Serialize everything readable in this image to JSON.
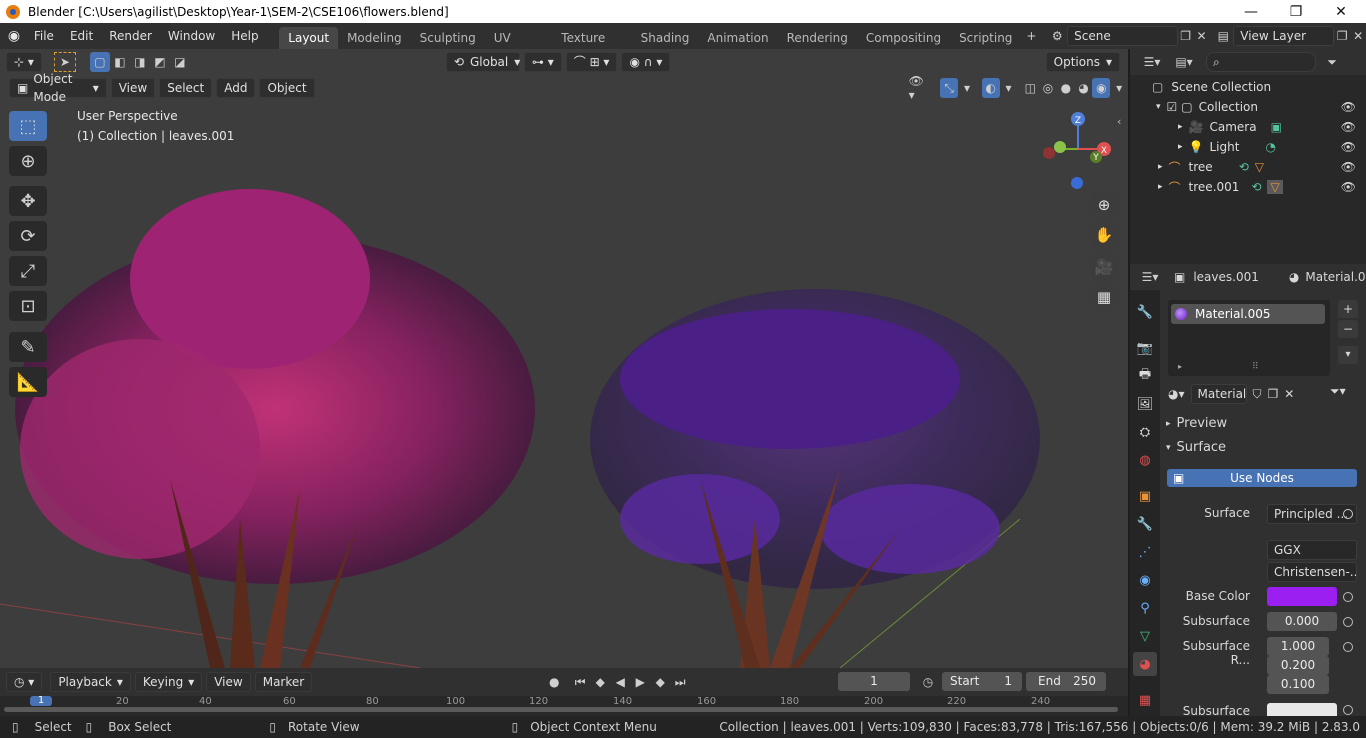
{
  "window": {
    "title": "Blender [C:\\Users\\agilist\\Desktop\\Year-1\\SEM-2\\CSE106\\flowers.blend]",
    "minimize": "—",
    "maximize": "❐",
    "close": "✕"
  },
  "menu": [
    "File",
    "Edit",
    "Render",
    "Window",
    "Help"
  ],
  "workspaces": [
    "Layout",
    "Modeling",
    "Sculpting",
    "UV Editing",
    "Texture Paint",
    "Shading",
    "Animation",
    "Rendering",
    "Compositing",
    "Scripting"
  ],
  "scene": {
    "label": "Scene",
    "view_layer": "View Layer"
  },
  "viewport": {
    "transform_orientation": "Global",
    "mode": "Object Mode",
    "header_menus": [
      "View",
      "Select",
      "Add",
      "Object"
    ],
    "overlay_title": "User Perspective",
    "overlay_subtitle": "(1) Collection | leaves.001",
    "options": "Options",
    "gizmo": {
      "x": "X",
      "y": "Y",
      "z": "Z"
    }
  },
  "outliner": {
    "scene_collection": "Scene Collection",
    "items": [
      {
        "name": "Collection"
      },
      {
        "name": "Camera"
      },
      {
        "name": "Light"
      },
      {
        "name": "tree"
      },
      {
        "name": "tree.001"
      }
    ]
  },
  "properties": {
    "object_name": "leaves.001",
    "material_tab": "Material.0",
    "slot": "Material.005",
    "material_field": "Material...",
    "panels": {
      "preview": "Preview",
      "surface": "Surface"
    },
    "use_nodes": "Use Nodes",
    "surface_label": "Surface",
    "surface_value": "Principled ...",
    "distribution": "GGX",
    "subsurface_method": "Christensen-...",
    "base_color_label": "Base Color",
    "base_color": "#9b1ff0",
    "subsurface_label": "Subsurface",
    "subsurface_value": "0.000",
    "subsurface_radius_label": "Subsurface R...",
    "subsurface_radius": [
      "1.000",
      "0.200",
      "0.100"
    ],
    "subsurface_color_label": "Subsurface C..."
  },
  "timeline": {
    "menus": [
      "Playback",
      "Keying",
      "View",
      "Marker"
    ],
    "current_frame": "1",
    "start_label": "Start",
    "start": "1",
    "end_label": "End",
    "end": "250",
    "ticks": [
      "1",
      "20",
      "40",
      "60",
      "80",
      "100",
      "120",
      "140",
      "160",
      "180",
      "200",
      "220",
      "240"
    ]
  },
  "statusbar": {
    "select": "Select",
    "box_select": "Box Select",
    "rotate_view": "Rotate View",
    "context_menu": "Object Context Menu",
    "stats": "Collection | leaves.001 | Verts:109,830 | Faces:83,778 | Tris:167,556 | Objects:0/6 | Mem: 39.2 MiB | 2.83.0"
  }
}
